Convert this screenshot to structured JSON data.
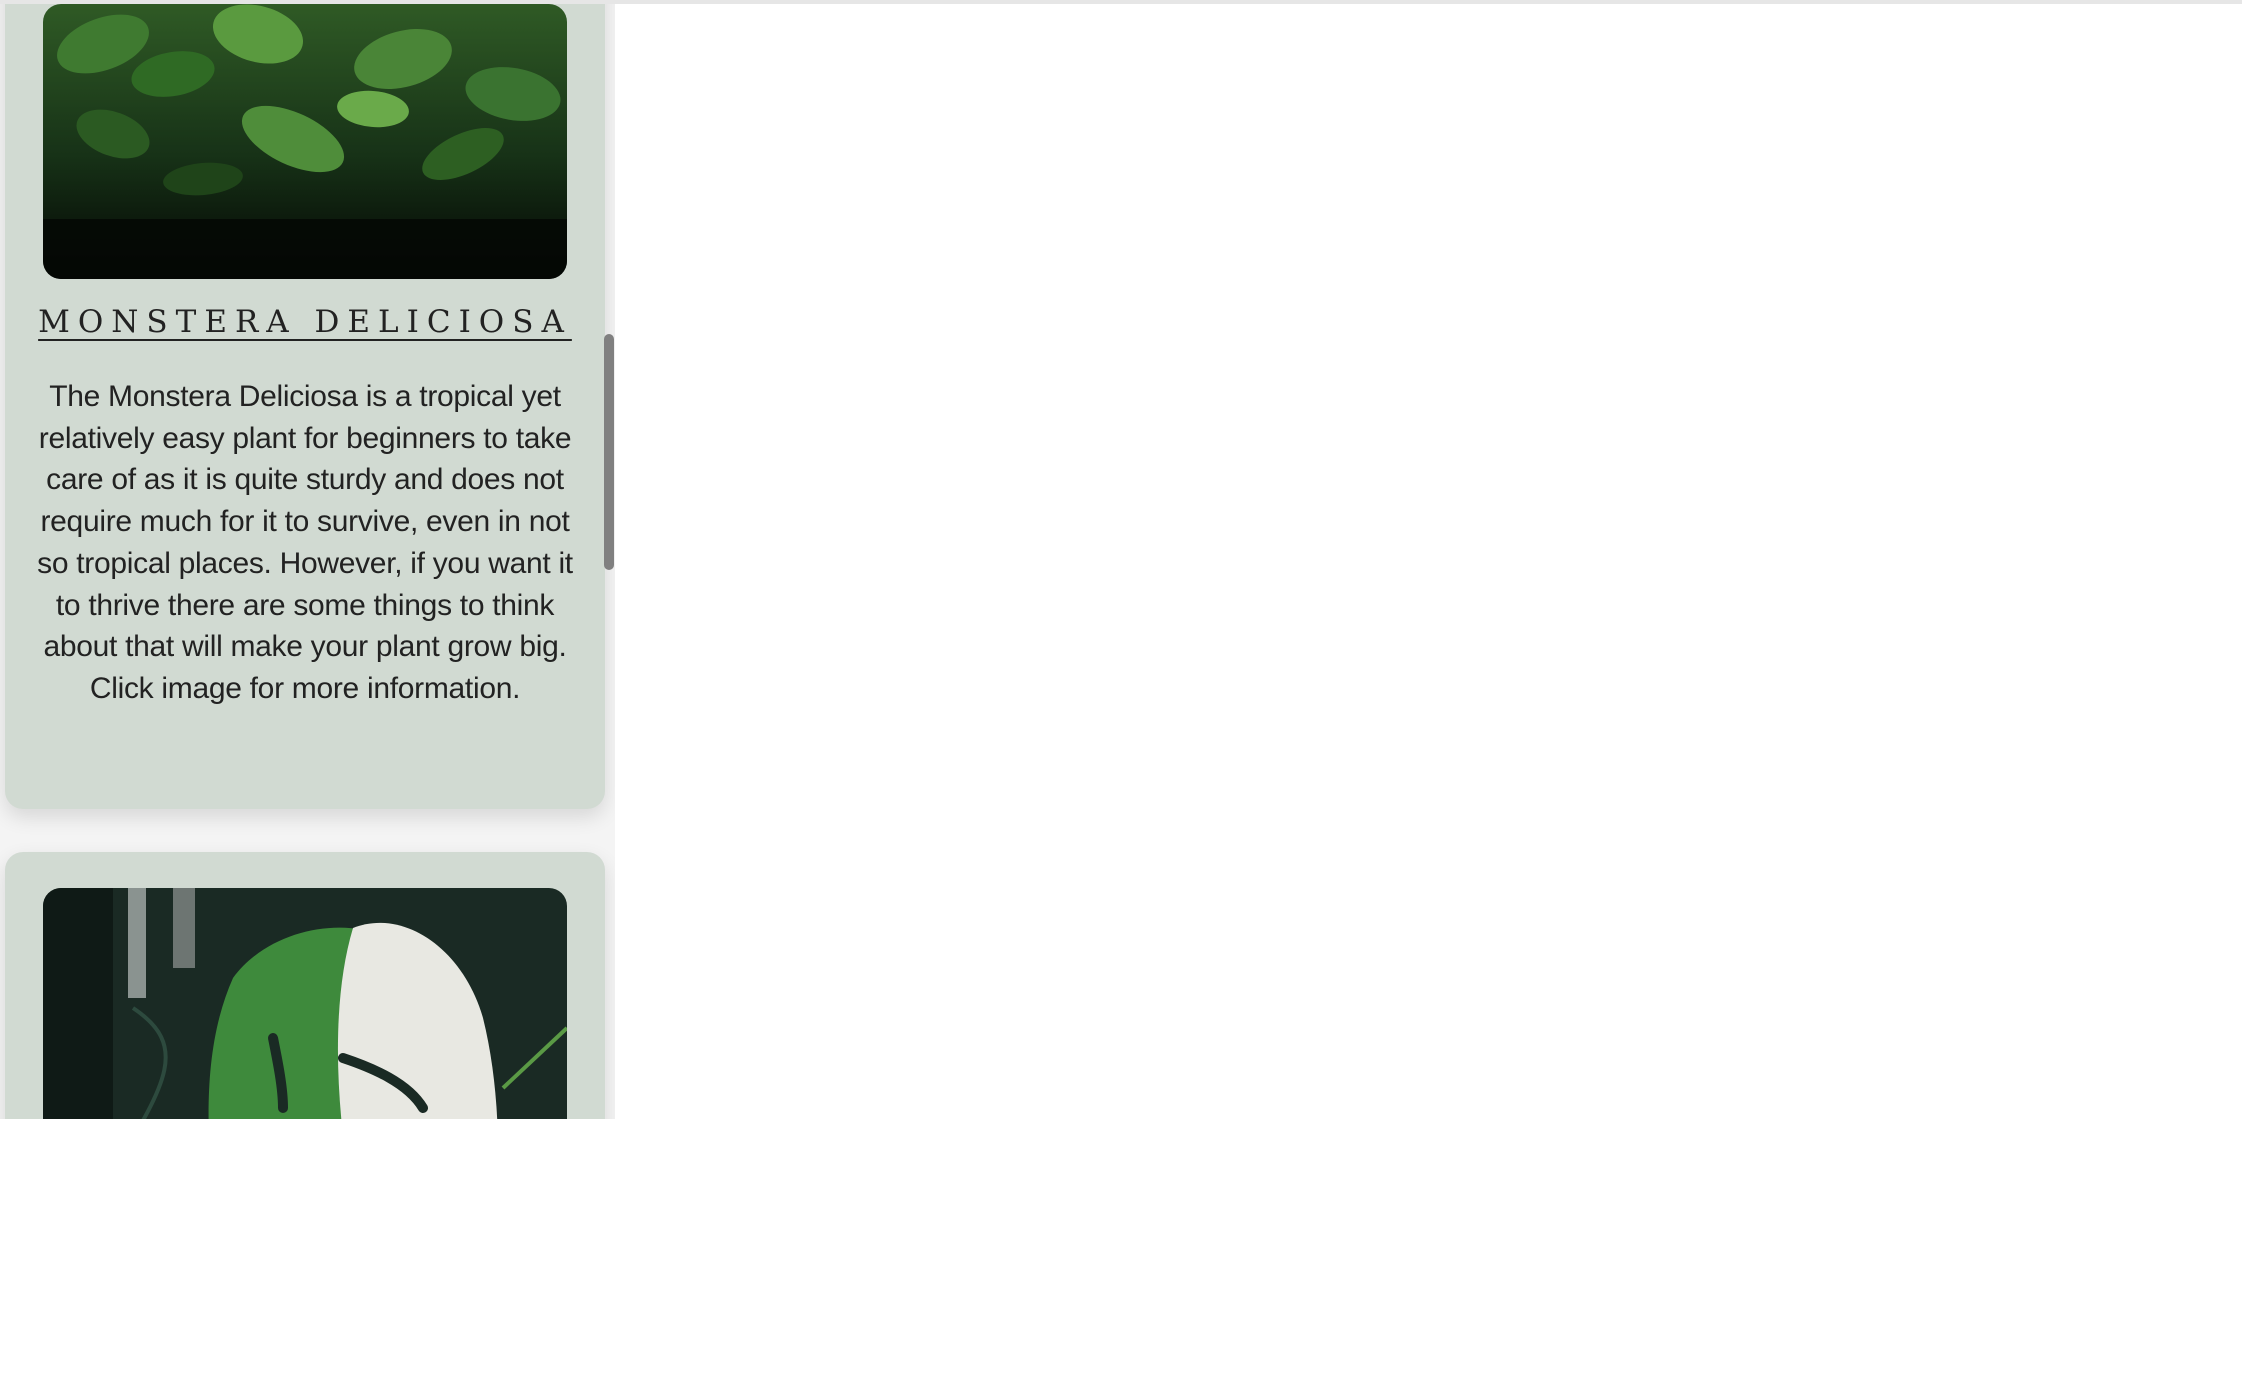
{
  "cards": [
    {
      "title": "MONSTERA DELICIOSA",
      "description": "The Monstera Deliciosa is a tropical yet relatively easy plant for beginners to take care of as it is quite sturdy and does not require much for it to survive, even in not so tropical places. However, if you want it to thrive there are some things to think about that will make your plant grow big. Click image for more information.",
      "image": "dense tropical jungle foliage"
    },
    {
      "image": "variegated monstera leaf"
    }
  ],
  "colors": {
    "card_background": "#d1dad2",
    "page_background": "#ffffff",
    "scrollbar_thumb": "#808080",
    "text": "#222222"
  },
  "icons": {
    "scrollbar": "scrollbar-thumb"
  }
}
